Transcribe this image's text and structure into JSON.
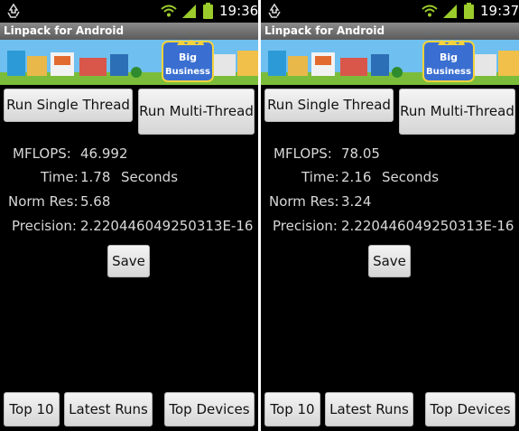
{
  "screens": [
    {
      "status_time": "19:36",
      "app_title": "Linpack for Android",
      "banner_logo_text": "Big Business",
      "buttons": {
        "single_thread": "Run Single Thread",
        "multi_thread": "Run Multi-Thread",
        "save": "Save",
        "top10": "Top 10",
        "latest_runs": "Latest Runs",
        "top_devices": "Top Devices"
      },
      "results": {
        "mflops_label": "MFLOPS:",
        "mflops_value": "46.992",
        "time_label": "Time:",
        "time_value": "1.78",
        "time_unit": "Seconds",
        "norm_res_label": "Norm Res:",
        "norm_res_value": "5.68",
        "precision_label": "Precision:",
        "precision_value": "2.220446049250313E-16"
      }
    },
    {
      "status_time": "19:37",
      "app_title": "Linpack for Android",
      "banner_logo_text": "Big Business",
      "buttons": {
        "single_thread": "Run Single Thread",
        "multi_thread": "Run Multi-Thread",
        "save": "Save",
        "top10": "Top 10",
        "latest_runs": "Latest Runs",
        "top_devices": "Top Devices"
      },
      "results": {
        "mflops_label": "MFLOPS:",
        "mflops_value": "78.05",
        "time_label": "Time:",
        "time_value": "2.16",
        "time_unit": "Seconds",
        "norm_res_label": "Norm Res:",
        "norm_res_value": "3.24",
        "precision_label": "Precision:",
        "precision_value": "2.220446049250313E-16"
      }
    }
  ],
  "colors": {
    "status_icons": "#9ccc2c",
    "titlebar_top": "#8a8a8a",
    "titlebar_bottom": "#5b5b5b",
    "result_text": "#d8d8d8"
  }
}
